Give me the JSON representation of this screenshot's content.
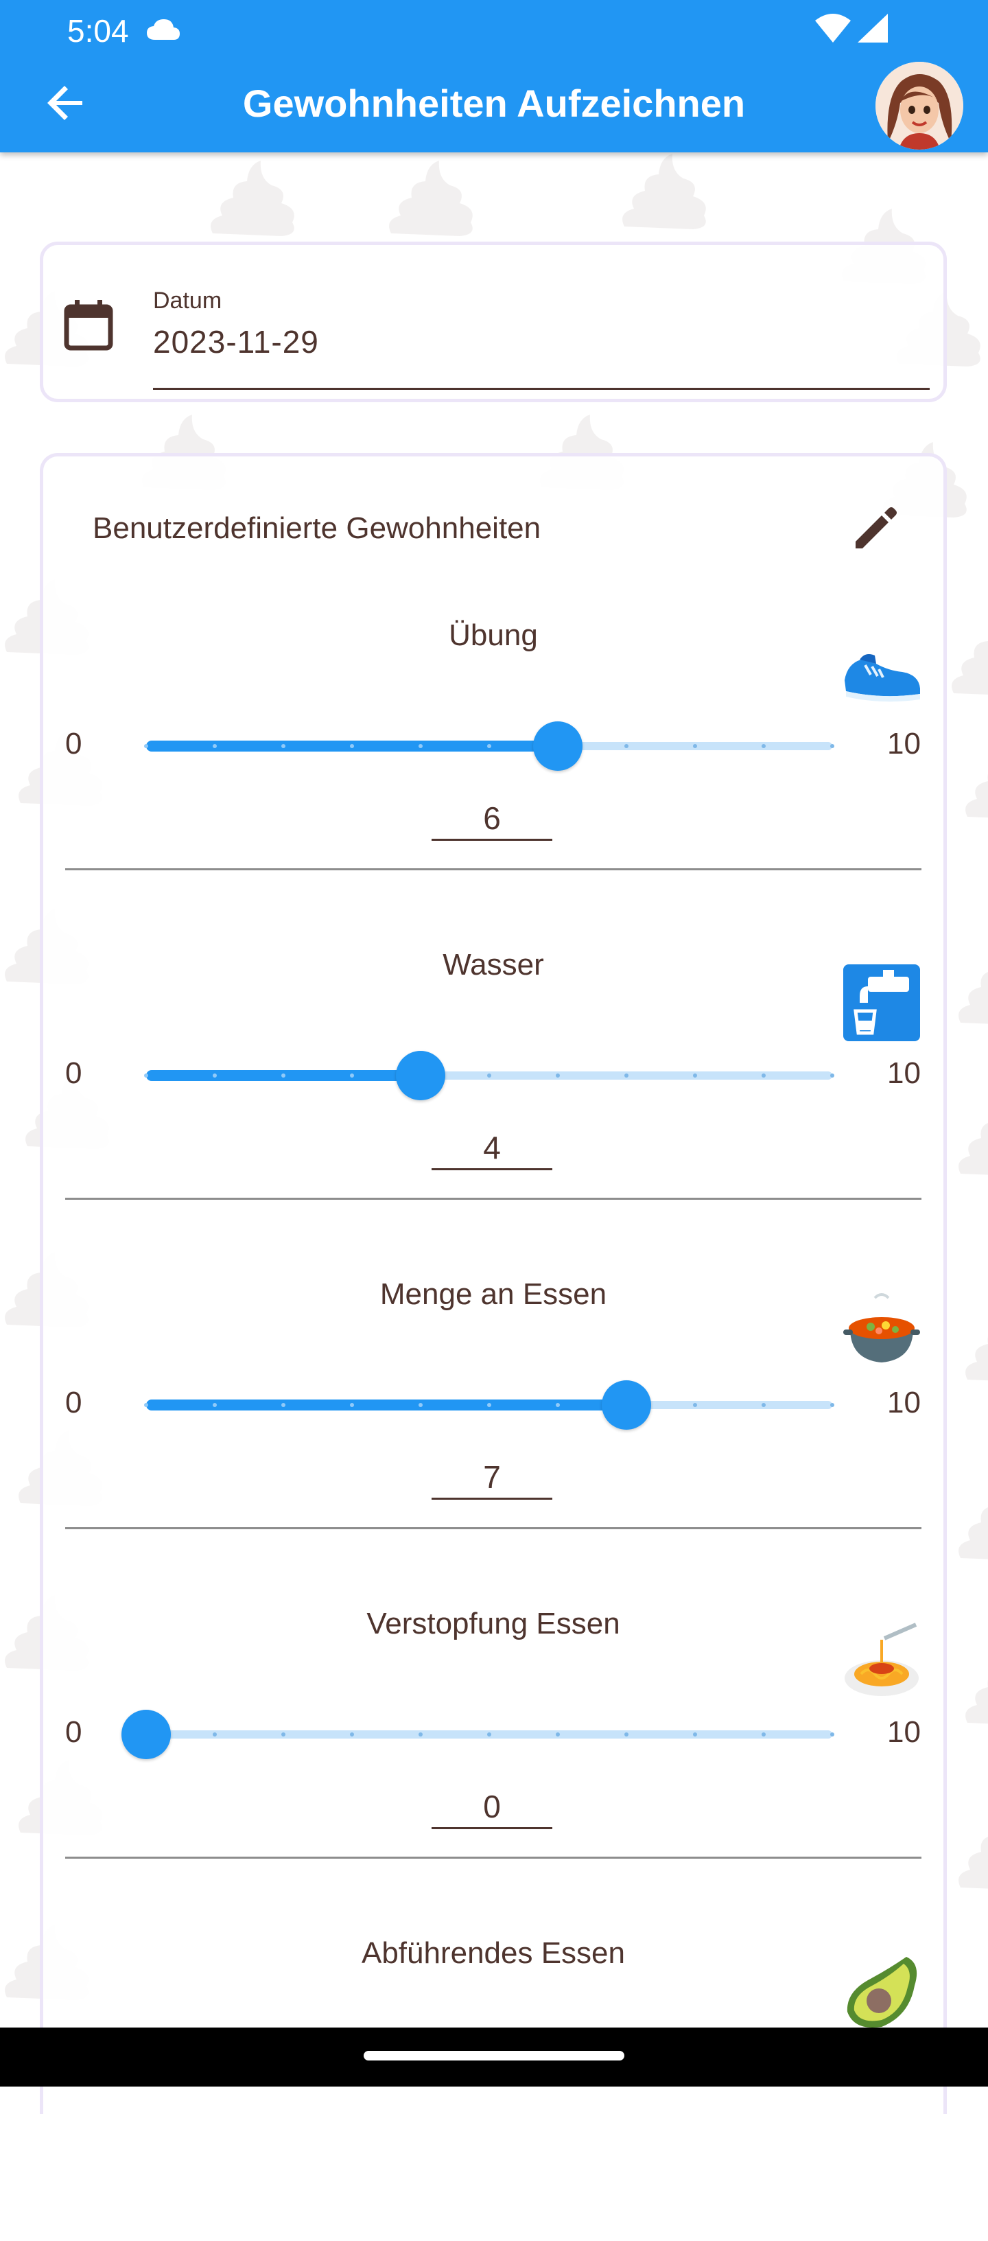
{
  "status_bar": {
    "time": "5:04"
  },
  "app_bar": {
    "title": "Gewohnheiten Aufzeichnen"
  },
  "date_card": {
    "label": "Datum",
    "value": "2023-11-29"
  },
  "habits_card": {
    "title": "Benutzerdefinierte Gewohnheiten",
    "habits": [
      {
        "name": "Übung",
        "icon": "running-shoe-icon",
        "min": "0",
        "max": "10",
        "value": "6",
        "fraction": 0.6
      },
      {
        "name": "Wasser",
        "icon": "water-tap-icon",
        "min": "0",
        "max": "10",
        "value": "4",
        "fraction": 0.4
      },
      {
        "name": "Menge an Essen",
        "icon": "pot-of-food-icon",
        "min": "0",
        "max": "10",
        "value": "7",
        "fraction": 0.7
      },
      {
        "name": "Verstopfung Essen",
        "icon": "spaghetti-icon",
        "min": "0",
        "max": "10",
        "value": "0",
        "fraction": 0.0
      },
      {
        "name": "Abführendes Essen",
        "icon": "avocado-icon"
      }
    ]
  },
  "colors": {
    "primary": "#2196f3",
    "track_inactive": "#c7e3fa",
    "text": "#4e342e",
    "card_border": "#ece5f8"
  }
}
